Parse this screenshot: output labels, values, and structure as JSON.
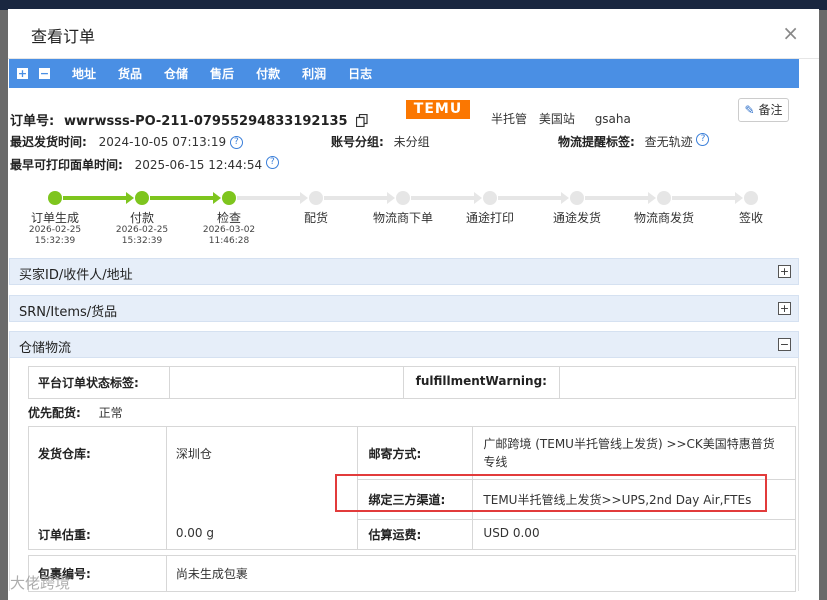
{
  "modal": {
    "title": "查看订单",
    "close_label": "×"
  },
  "toolbar": {
    "expand_label": "+",
    "collapse_label": "−",
    "links": [
      "地址",
      "货品",
      "仓储",
      "售后",
      "付款",
      "利润",
      "日志"
    ]
  },
  "order": {
    "order_no_label": "订单号:",
    "order_no": "wwrwsss-PO-211-07955294833192135",
    "platform": "TEMU",
    "mode": "半托管",
    "site": "美国站",
    "account": "gsaha",
    "note_label": "备注",
    "latest_ship_label": "最迟发货时间:",
    "latest_ship_time": "2024-10-05 07:13:19",
    "account_group_label": "账号分组:",
    "account_group": "未分组",
    "logistics_tag_label": "物流提醒标签:",
    "logistics_tag": "查无轨迹",
    "earliest_print_label": "最早可打印面单时间:",
    "earliest_print_time": "2025-06-15 12:44:54"
  },
  "progress": {
    "steps": [
      {
        "label": "订单生成",
        "date": "2026-02-25",
        "time": "15:32:39",
        "done": true
      },
      {
        "label": "付款",
        "date": "2026-02-25",
        "time": "15:32:39",
        "done": true
      },
      {
        "label": "检查",
        "date": "2026-03-02",
        "time": "11:46:28",
        "done": true
      },
      {
        "label": "配货",
        "date": "",
        "time": "",
        "done": false
      },
      {
        "label": "物流商下单",
        "date": "",
        "time": "",
        "done": false
      },
      {
        "label": "通途打印",
        "date": "",
        "time": "",
        "done": false
      },
      {
        "label": "通途发货",
        "date": "",
        "time": "",
        "done": false
      },
      {
        "label": "物流商发货",
        "date": "",
        "time": "",
        "done": false
      },
      {
        "label": "签收",
        "date": "",
        "time": "",
        "done": false
      }
    ]
  },
  "sections": {
    "buyer": "买家ID/收件人/地址",
    "items": "SRN/Items/货品",
    "warehouse": "仓储物流"
  },
  "warehouse": {
    "platform_status_label": "平台订单状态标签:",
    "platform_status_value": "",
    "fulfillment_warning_label": "fulfillmentWarning:",
    "fulfillment_warning_value": "",
    "priority_label": "优先配货:",
    "priority_value": "正常",
    "ship_warehouse_label": "发货仓库:",
    "ship_warehouse_value": "深圳仓",
    "shipping_method_label": "邮寄方式:",
    "shipping_method_value": "广邮跨境 (TEMU半托管线上发货) >>CK美国特惠普货专线",
    "third_party_label": "绑定三方渠道:",
    "third_party_value": "TEMU半托管线上发货>>UPS,2nd Day Air,FTEs",
    "order_weight_label": "订单估重:",
    "order_weight_value": "0.00 g",
    "est_freight_label": "估算运费:",
    "est_freight_value": "USD 0.00",
    "package_no_label": "包裹编号:",
    "package_no_value": "尚未生成包裹"
  },
  "watermark": "大佬跨境"
}
